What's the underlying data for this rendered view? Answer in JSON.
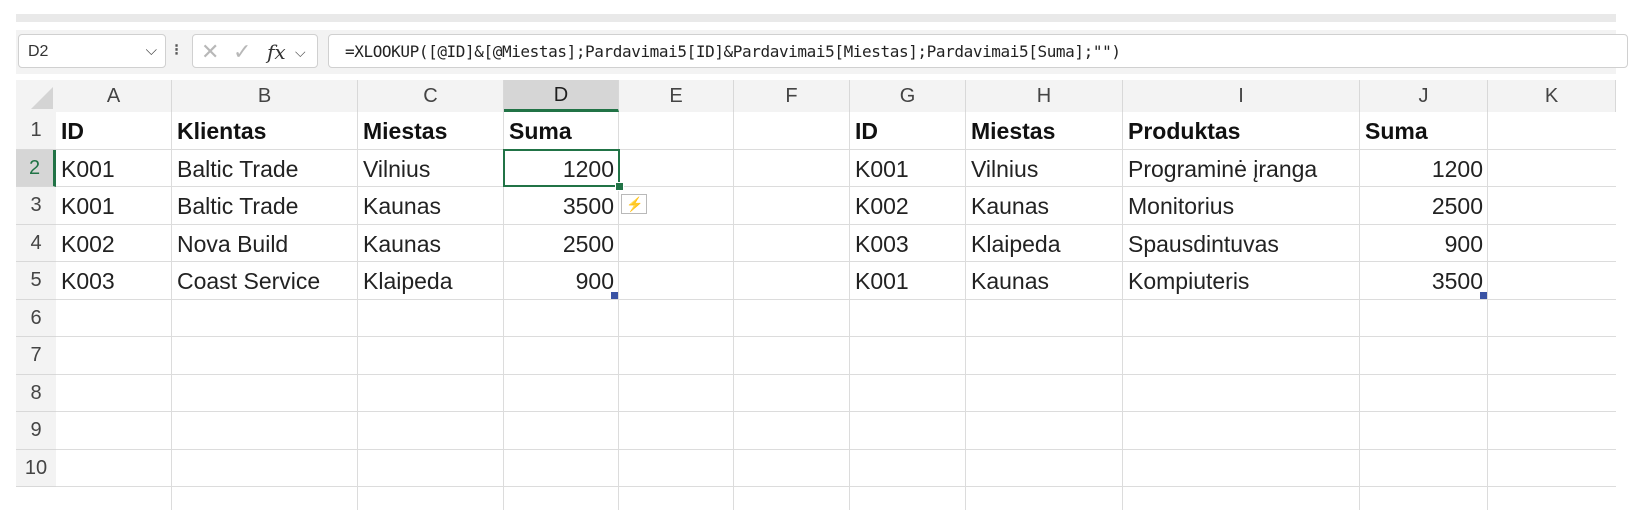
{
  "name_box": {
    "value": "D2"
  },
  "formula_bar": {
    "cancel_glyph": "✕",
    "enter_glyph": "✓",
    "fx_label": "fx",
    "formula": "=XLOOKUP([@ID]&[@Miestas];Pardavimai5[ID]&Pardavimai5[Miestas];Pardavimai5[Suma];\"\")"
  },
  "columns": [
    "A",
    "B",
    "C",
    "D",
    "E",
    "F",
    "G",
    "H",
    "I",
    "J",
    "K"
  ],
  "selected_column": "D",
  "rows": [
    "1",
    "2",
    "3",
    "4",
    "5",
    "6",
    "7",
    "8",
    "9",
    "10"
  ],
  "selected_row": "2",
  "table1": {
    "headers": [
      "ID",
      "Klientas",
      "Miestas",
      "Suma"
    ],
    "rows": [
      [
        "K001",
        "Baltic Trade",
        "Vilnius",
        "1200"
      ],
      [
        "K001",
        "Baltic Trade",
        "Kaunas",
        "3500"
      ],
      [
        "K002",
        "Nova Build",
        "Kaunas",
        "2500"
      ],
      [
        "K003",
        "Coast Service",
        "Klaipeda",
        "900"
      ]
    ]
  },
  "table2": {
    "headers": [
      "ID",
      "Miestas",
      "Produktas",
      "Suma"
    ],
    "rows": [
      [
        "K001",
        "Vilnius",
        "Programinė įranga",
        "1200"
      ],
      [
        "K002",
        "Kaunas",
        "Monitorius",
        "2500"
      ],
      [
        "K003",
        "Klaipeda",
        "Spausdintuvas",
        "900"
      ],
      [
        "K001",
        "Kaunas",
        "Kompiuteris",
        "3500"
      ]
    ]
  },
  "icons": {
    "name_box_dropdown": "chevron-down-icon",
    "more_options": "vertical-dots-icon",
    "cancel": "cancel-icon",
    "enter": "check-icon",
    "insert_function": "fx-icon",
    "quick_analysis": "quick-analysis-icon"
  },
  "colors": {
    "selection": "#217346",
    "table_handle": "#3a53a4",
    "quick_analysis": "#e28a1b"
  }
}
